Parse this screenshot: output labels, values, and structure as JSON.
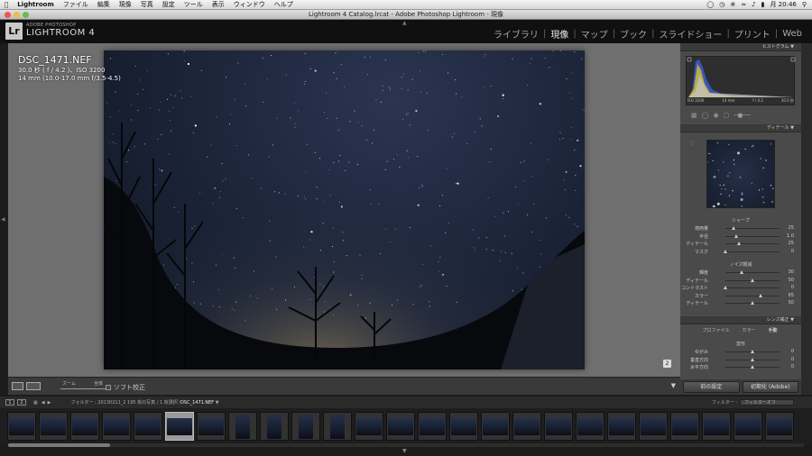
{
  "menubar": {
    "apple": "",
    "items": [
      "Lightroom",
      "ファイル",
      "編集",
      "現像",
      "写真",
      "設定",
      "ツール",
      "表示",
      "ウィンドウ",
      "ヘルプ"
    ],
    "clock": "月 20:46"
  },
  "window": {
    "title": "Lightroom 4 Catalog.lrcat - Adobe Photoshop Lightroom - 現像"
  },
  "identity": {
    "logo": "Lr",
    "brand_top": "ADOBE PHOTOSHOP",
    "brand_main": "LIGHTROOM 4"
  },
  "modules": [
    "ライブラリ",
    "現像",
    "マップ",
    "ブック",
    "スライドショー",
    "プリント",
    "Web"
  ],
  "active_module": "現像",
  "info": {
    "filename": "DSC_1471.NEF",
    "exposure": "30.0 秒 ( f / 4.2 )、ISO 3200",
    "lens": "14 mm (10.0-17.0 mm f/3.5-4.5)"
  },
  "toolbar": {
    "zoom_label": "ズーム",
    "full_label": "全体",
    "softproof": "ソフト校正"
  },
  "panels": {
    "histogram": "ヒストグラム",
    "histogram_info": [
      "ISO 3200",
      "14 mm",
      "f / 4.2",
      "30.0 秒"
    ],
    "detail": "ディテール",
    "sharpen": "シャープ",
    "noise": "ノイズ軽減",
    "lens": "レンズ補正",
    "transform": "変形"
  },
  "sharpen_sliders": [
    {
      "label": "適用量",
      "value": "25",
      "pos": 0.15
    },
    {
      "label": "半径",
      "value": "1.0",
      "pos": 0.2
    },
    {
      "label": "ディテール",
      "value": "25",
      "pos": 0.25
    },
    {
      "label": "マスク",
      "value": "0",
      "pos": 0.0
    }
  ],
  "noise_sliders": [
    {
      "label": "輝度",
      "value": "30",
      "pos": 0.3
    },
    {
      "label": "ディテール",
      "value": "50",
      "pos": 0.5
    },
    {
      "label": "コントラスト",
      "value": "0",
      "pos": 0.0
    },
    {
      "label": "カラー",
      "value": "65",
      "pos": 0.65
    },
    {
      "label": "ディテール",
      "value": "50",
      "pos": 0.5
    }
  ],
  "lens_tabs": [
    "プロファイル",
    "カラー",
    "手動"
  ],
  "transform_sliders": [
    {
      "label": "ゆがみ",
      "value": "0",
      "pos": 0.5
    },
    {
      "label": "垂直方向",
      "value": "0",
      "pos": 0.5
    },
    {
      "label": "水平方向",
      "value": "0",
      "pos": 0.5
    }
  ],
  "buttons": {
    "previous": "前の設定",
    "reset": "初期化 (Adobe)"
  },
  "filmstrip": {
    "pages": [
      "1",
      "2"
    ],
    "path": "フォルダー : 20130211_2  195 枚の写真 / 1 枚選択 /",
    "selected_file": "DSC_1471.NEF",
    "filter_label": "フィルター :",
    "filter_value": "フィルターオフ"
  },
  "colors": {
    "accent": "#ffffff",
    "panel": "#4a4a4a",
    "background": "#1c1c1c"
  }
}
